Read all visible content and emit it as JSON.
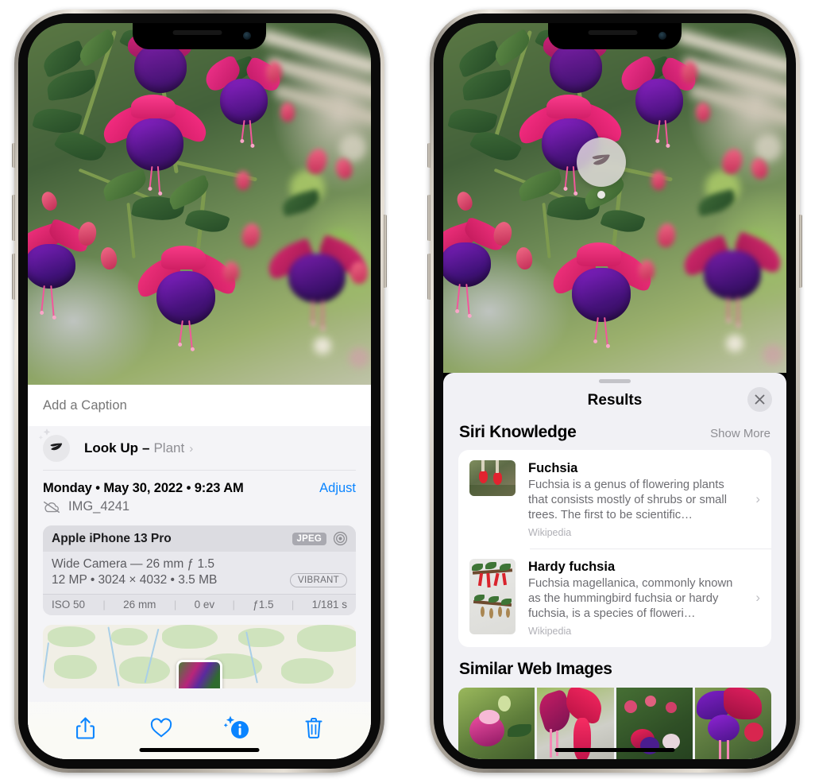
{
  "left_phone": {
    "name": "iphone-photos-info-view",
    "caption_field": {
      "placeholder": "Add a Caption",
      "value": ""
    },
    "look_up": {
      "label": "Look Up",
      "dash": "–",
      "subject": "Plant",
      "chevron": "›",
      "icon": "leaf-icon"
    },
    "date_line": "Monday • May 30, 2022 • 9:23 AM",
    "adjust_label": "Adjust",
    "file_name": "IMG_4241",
    "cloud_icon": "icloud-slash-icon",
    "exif": {
      "device": "Apple iPhone 13 Pro",
      "format_badge": "JPEG",
      "raw_icon": "camera-aperture-icon",
      "lens_line": "Wide Camera — 26 mm ƒ 1.5",
      "specs_line": "12 MP • 3024 × 4032 • 3.5 MB",
      "style_badge": "VIBRANT",
      "stats": [
        "ISO 50",
        "26 mm",
        "0 ev",
        "ƒ1.5",
        "1/181 s"
      ]
    },
    "toolbar": [
      {
        "name": "share-button",
        "icon": "share-icon"
      },
      {
        "name": "favorite-button",
        "icon": "heart-icon"
      },
      {
        "name": "info-button",
        "icon": "info-sparkle-icon"
      },
      {
        "name": "delete-button",
        "icon": "trash-icon"
      }
    ],
    "accent_color": "#0a84ff"
  },
  "right_phone": {
    "name": "iphone-visual-lookup-results",
    "badge_icon": "leaf-icon",
    "sheet": {
      "grabber": "drag-handle",
      "title": "Results",
      "close_icon": "close-icon"
    },
    "siri_knowledge": {
      "heading": "Siri Knowledge",
      "show_more": "Show More",
      "items": [
        {
          "title": "Fuchsia",
          "description": "Fuchsia is a genus of flowering plants that consists mostly of shrubs or small trees. The first to be scientific…",
          "source": "Wikipedia",
          "chevron": "›"
        },
        {
          "title": "Hardy fuchsia",
          "description": "Fuchsia magellanica, commonly known as the hummingbird fuchsia or hardy fuchsia, is a species of floweri…",
          "source": "Wikipedia",
          "chevron": "›"
        }
      ]
    },
    "similar_web_images": {
      "heading": "Similar Web Images",
      "tiles": [
        "web-image-1",
        "web-image-2",
        "web-image-3",
        "web-image-4"
      ]
    }
  }
}
